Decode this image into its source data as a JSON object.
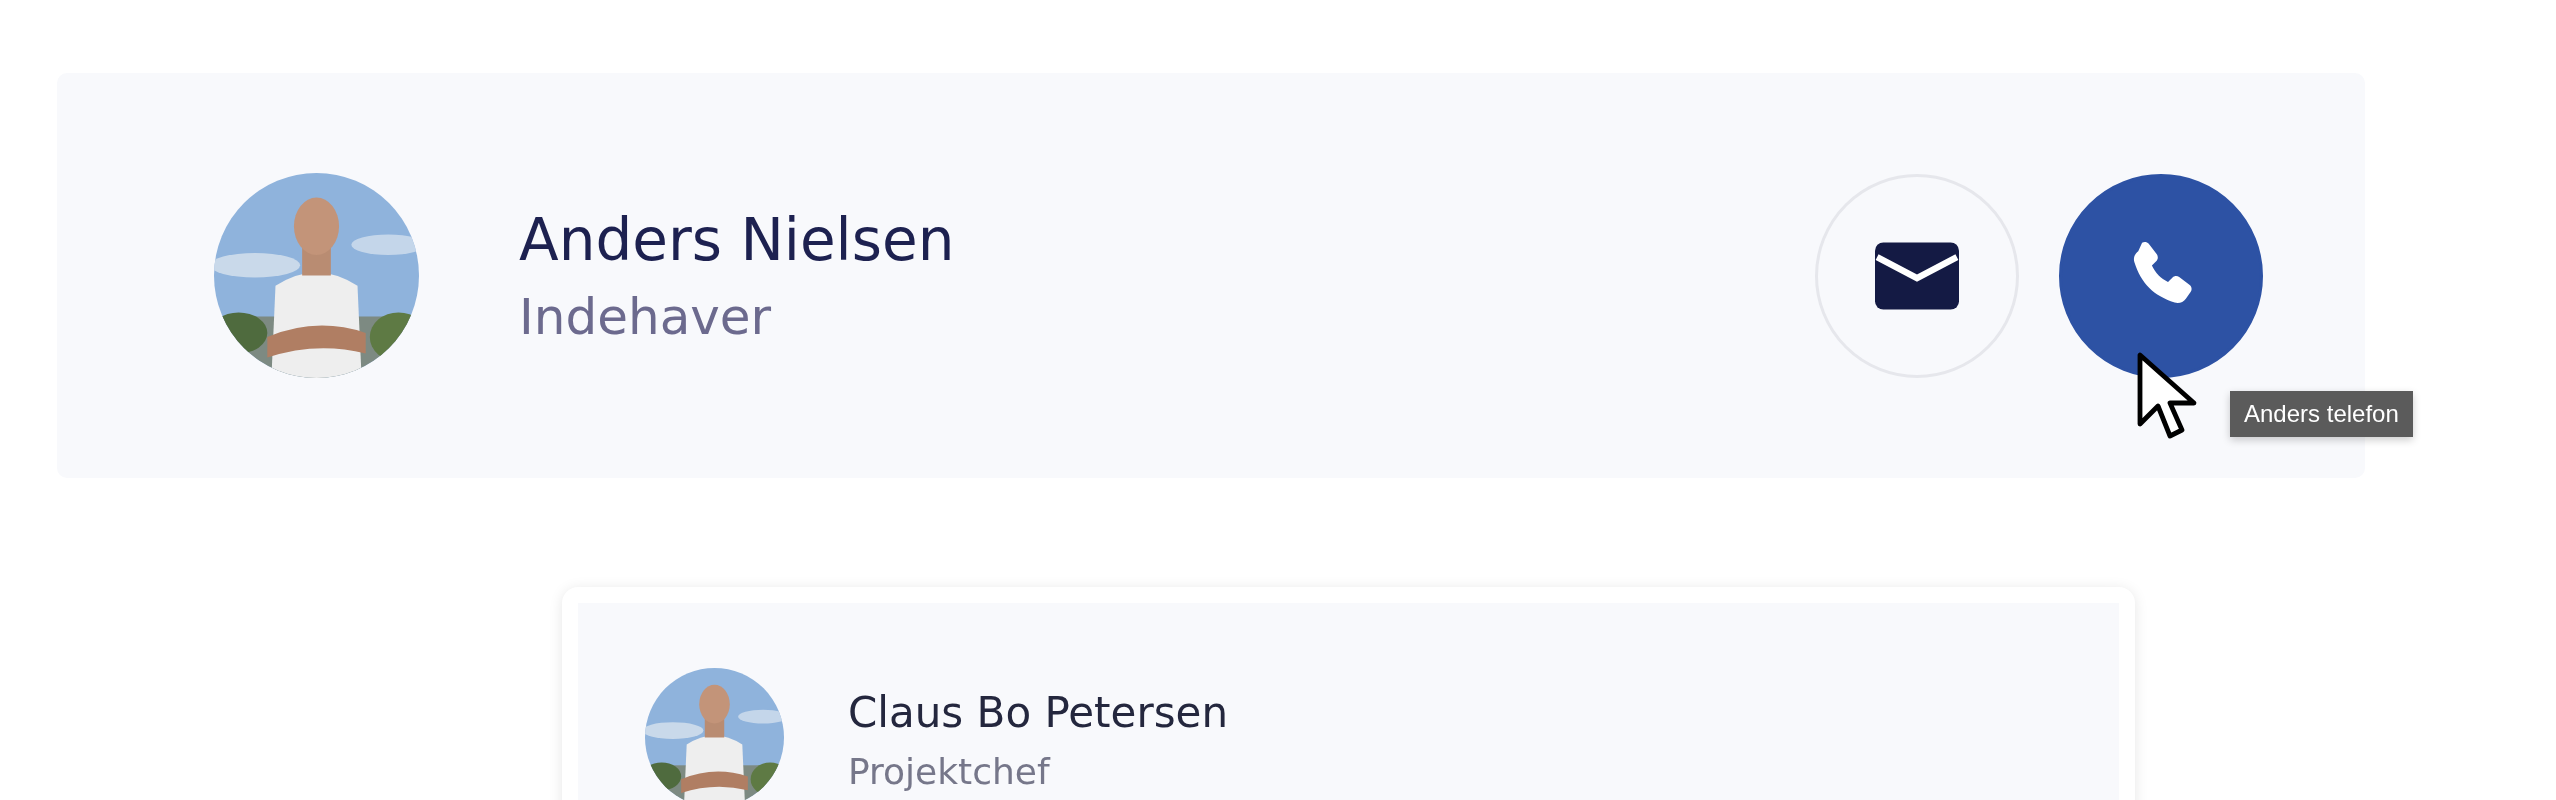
{
  "contact": {
    "name": "Anders Nielsen",
    "role": "Indehaver",
    "actions": [
      {
        "kind": "email",
        "hovered": false
      },
      {
        "kind": "phone",
        "hovered": true
      }
    ],
    "tooltip": "Anders telefon"
  },
  "team": [
    {
      "name": "Claus Bo Petersen",
      "role": "Projektchef"
    }
  ]
}
